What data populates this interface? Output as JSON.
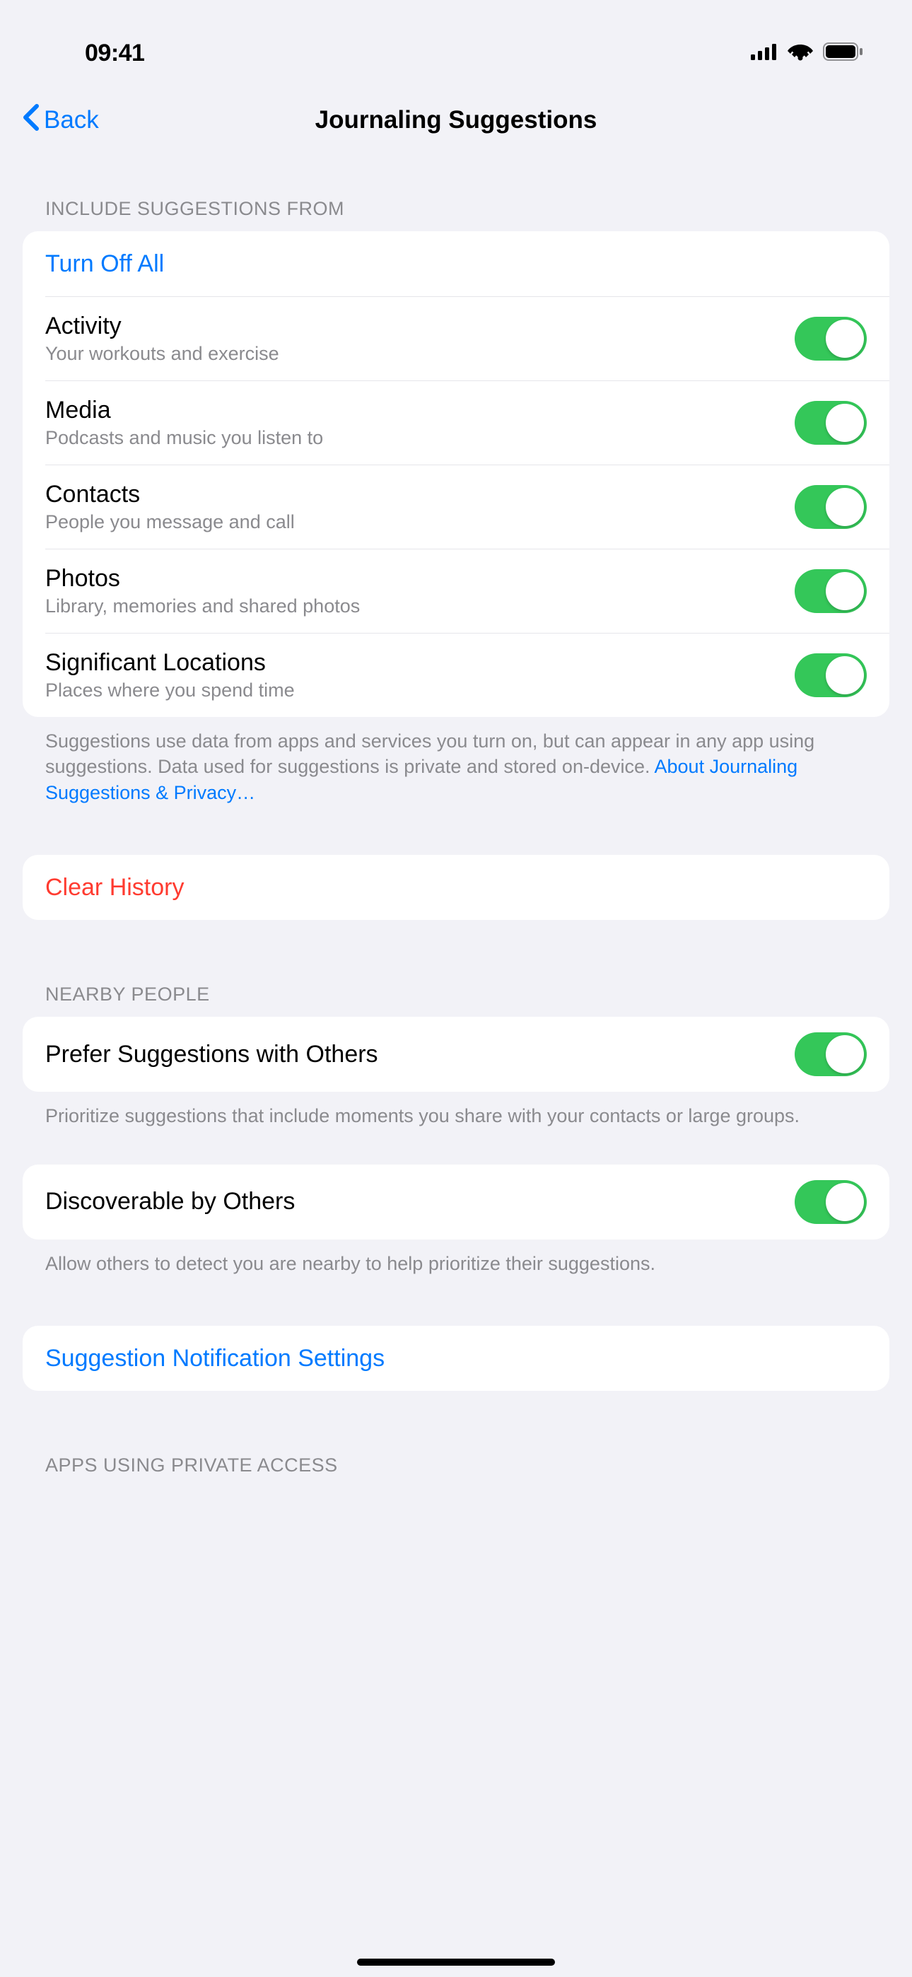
{
  "status": {
    "time": "09:41"
  },
  "nav": {
    "back_label": "Back",
    "title": "Journaling Suggestions"
  },
  "sections": {
    "include": {
      "header": "INCLUDE SUGGESTIONS FROM",
      "turn_off_all": "Turn Off All",
      "items": [
        {
          "title": "Activity",
          "subtitle": "Your workouts and exercise",
          "enabled": true
        },
        {
          "title": "Media",
          "subtitle": "Podcasts and music you listen to",
          "enabled": true
        },
        {
          "title": "Contacts",
          "subtitle": "People you message and call",
          "enabled": true
        },
        {
          "title": "Photos",
          "subtitle": "Library, memories and shared photos",
          "enabled": true
        },
        {
          "title": "Significant Locations",
          "subtitle": "Places where you spend time",
          "enabled": true
        }
      ],
      "footer_text": "Suggestions use data from apps and services you turn on, but can appear in any app using suggestions. Data used for suggestions is private and stored on-device. ",
      "footer_link": "About Journaling Suggestions & Privacy…"
    },
    "clear_history": {
      "label": "Clear History"
    },
    "nearby": {
      "header": "NEARBY PEOPLE",
      "prefer": {
        "title": "Prefer Suggestions with Others",
        "enabled": true,
        "footer": "Prioritize suggestions that include moments you share with your contacts or large groups."
      },
      "discoverable": {
        "title": "Discoverable by Others",
        "enabled": true,
        "footer": "Allow others to detect you are nearby to help prioritize their suggestions."
      }
    },
    "notification": {
      "label": "Suggestion Notification Settings"
    },
    "apps_access": {
      "header": "APPS USING PRIVATE ACCESS"
    }
  }
}
